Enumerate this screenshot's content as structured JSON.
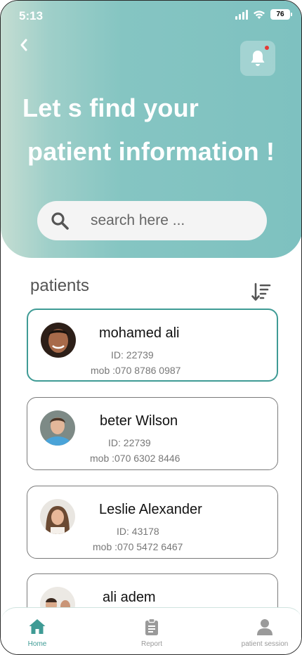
{
  "status_bar": {
    "time": "5:13",
    "battery": "76"
  },
  "header": {
    "title_line1": "Let s find your",
    "title_line2": "patient information !"
  },
  "search": {
    "placeholder": "search here ...",
    "value": ""
  },
  "patients": {
    "title": "patients",
    "items": [
      {
        "name": "mohamed ali",
        "id": "ID: 22739",
        "mob": "mob :070 8786 0987",
        "selected": true
      },
      {
        "name": "beter Wilson",
        "id": "ID: 22739",
        "mob": "mob :070 6302 8446",
        "selected": false
      },
      {
        "name": "Leslie Alexander",
        "id": "ID: 43178",
        "mob": "mob :070 5472 6467",
        "selected": false
      },
      {
        "name": "ali adem",
        "id": "",
        "mob": "",
        "selected": false
      }
    ]
  },
  "nav": {
    "items": [
      {
        "label": "Home",
        "icon": "home-icon",
        "active": true
      },
      {
        "label": "Report",
        "icon": "clipboard-icon",
        "active": false
      },
      {
        "label": "patient session",
        "icon": "user-icon",
        "active": false
      }
    ]
  },
  "colors": {
    "accent": "#3f9b95",
    "header_gradient_start": "#c4ddd2",
    "header_gradient_end": "#7ec1c0",
    "notification_dot": "#e53935"
  }
}
